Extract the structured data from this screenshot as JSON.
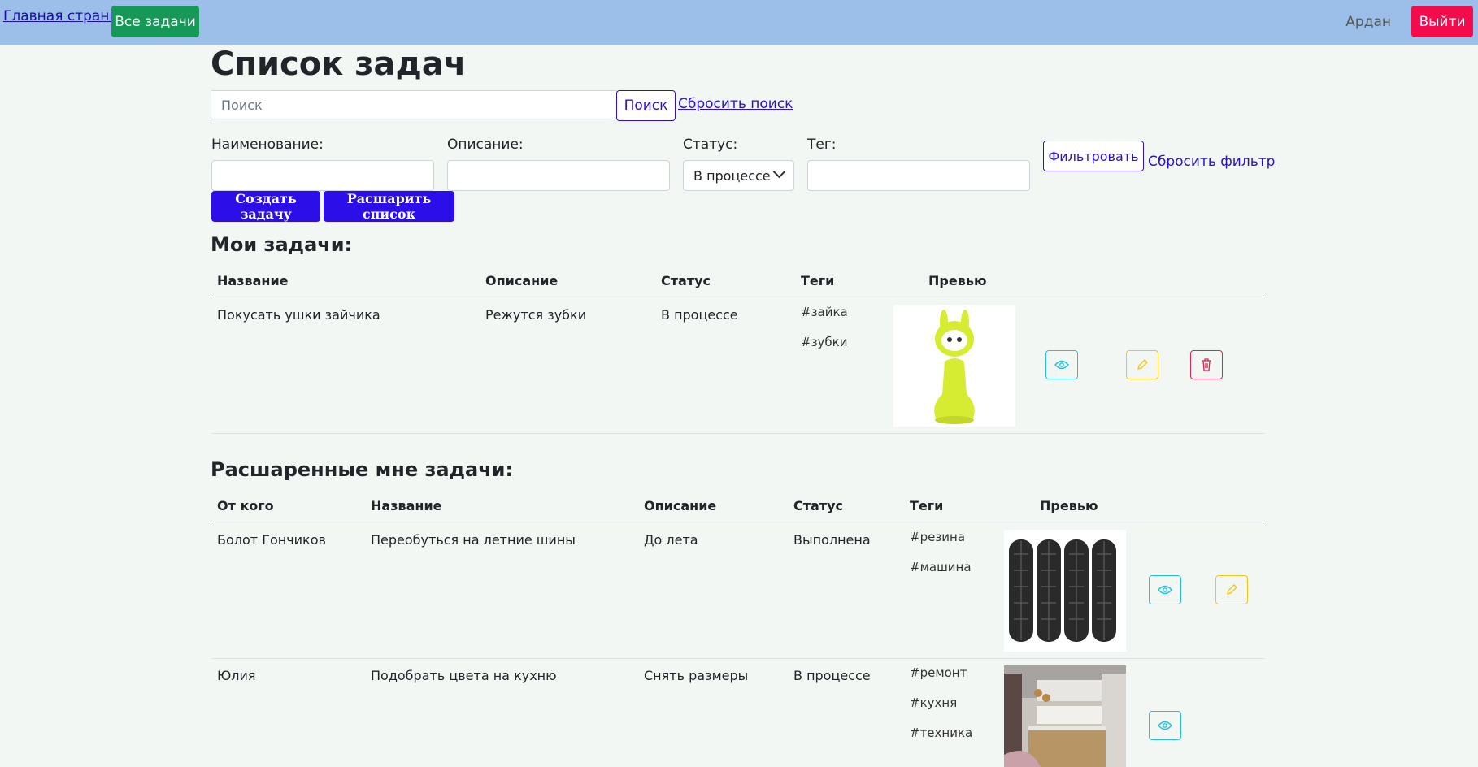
{
  "nav": {
    "home_link": "Главная страница",
    "all_tasks_button": "Все задачи",
    "username": "Ардан",
    "logout_button": "Выйти"
  },
  "page": {
    "title": "Список задач"
  },
  "search": {
    "placeholder": "Поиск",
    "value": "",
    "button": "Поиск",
    "reset_link": "Сбросить поиск"
  },
  "filter": {
    "name_label": "Наименование:",
    "name_value": "",
    "description_label": "Описание:",
    "description_value": "",
    "status_label": "Статус:",
    "status_selected": "В процессе",
    "tag_label": "Тег:",
    "tag_value": "",
    "filter_button": "Фильтровать",
    "reset_link": "Сбросить фильтр"
  },
  "actions": {
    "create_task": "Создать задачу",
    "share_list": "Расшарить список"
  },
  "my_tasks": {
    "title": "Мои задачи:",
    "columns": [
      "Название",
      "Описание",
      "Статус",
      "Теги",
      "Превью"
    ],
    "rows": [
      {
        "name": "Покусать ушки зайчика",
        "description": "Режутся зубки",
        "status": "В процессе",
        "tags": [
          "#зайка",
          "#зубки"
        ],
        "preview": "yellow-bunny-toy"
      }
    ]
  },
  "shared_tasks": {
    "title": "Расшаренные мне задачи:",
    "columns": [
      "От кого",
      "Название",
      "Описание",
      "Статус",
      "Теги",
      "Превью"
    ],
    "rows": [
      {
        "from": "Болот Гончиков",
        "name": "Переобуться на летние шины",
        "description": "До лета",
        "status": "Выполнена",
        "tags": [
          "#резина",
          "#машина"
        ],
        "preview": "four-car-tires"
      },
      {
        "from": "Юлия",
        "name": "Подобрать цвета на кухню",
        "description": "Снять размеры",
        "status": "В процессе",
        "tags": [
          "#ремонт",
          "#кухня",
          "#техника"
        ],
        "preview": "kitchen-interior"
      }
    ]
  },
  "colors": {
    "navbar": "#9bbfe8",
    "all_tasks_button": "#169957",
    "logout_button": "#f30b4c",
    "primary": "#2c0ee8",
    "link": "#2c0fd1",
    "view_icon": "#1fc3e0",
    "edit_icon": "#f3c41a",
    "delete_icon": "#e3214e"
  },
  "icons": {
    "view": "eye-icon",
    "edit": "pencil-icon",
    "delete": "trash-icon",
    "select": "chevron-down-icon"
  }
}
